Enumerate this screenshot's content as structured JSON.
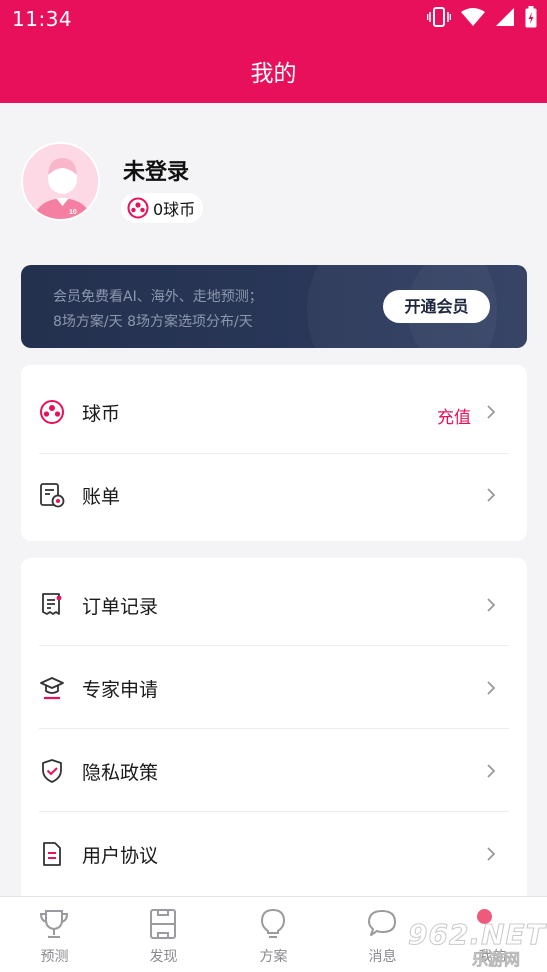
{
  "status_bar": {
    "time": "11:34"
  },
  "app_bar": {
    "title": "我的"
  },
  "profile": {
    "name": "未登录",
    "coins": "0球币"
  },
  "vip_banner": {
    "line1": "会员免费看AI、海外、走地预测；",
    "line2": "8场方案/天 8场方案选项分布/天",
    "button": "开通会员"
  },
  "menu_group_1": [
    {
      "label": "球币",
      "extra": "充值",
      "icon": "soccer-ball-icon"
    },
    {
      "label": "账单",
      "icon": "bill-icon"
    }
  ],
  "menu_group_2": [
    {
      "label": "订单记录",
      "icon": "receipt-icon"
    },
    {
      "label": "专家申请",
      "icon": "graduate-icon"
    },
    {
      "label": "隐私政策",
      "icon": "shield-check-icon"
    },
    {
      "label": "用户协议",
      "icon": "document-icon"
    }
  ],
  "tab_bar": [
    {
      "label": "预测",
      "icon": "trophy-icon"
    },
    {
      "label": "发现",
      "icon": "field-icon"
    },
    {
      "label": "方案",
      "icon": "bulb-icon"
    },
    {
      "label": "消息",
      "icon": "chat-bubble-icon"
    },
    {
      "label": "我的",
      "icon": "profile-icon"
    }
  ],
  "watermark": {
    "big": "962.NET",
    "small": "乐游网"
  },
  "colors": {
    "brand": "#e8105a",
    "vip_bg": "#23304e"
  }
}
